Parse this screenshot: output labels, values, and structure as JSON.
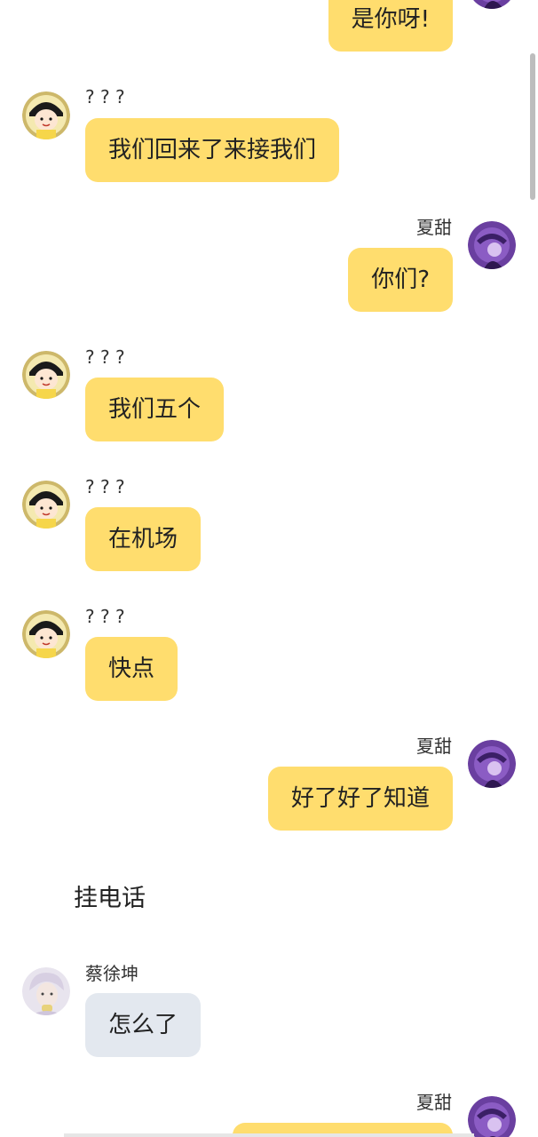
{
  "colors": {
    "bubble_yellow": "#ffdd6e",
    "bubble_grey": "#e3e8ef",
    "background": "#ffffff"
  },
  "messages": [
    {
      "sender": "",
      "side": "right",
      "avatar": "purple-avatar-icon",
      "text": "是你呀!"
    },
    {
      "sender": "? ? ?",
      "side": "left",
      "avatar": "maruko-avatar-icon",
      "text": "我们回来了来接我们"
    },
    {
      "sender": "夏甜",
      "side": "right",
      "avatar": "purple-avatar-icon",
      "text": "你们?"
    },
    {
      "sender": "? ? ?",
      "side": "left",
      "avatar": "maruko-avatar-icon",
      "text": "我们五个"
    },
    {
      "sender": "? ? ?",
      "side": "left",
      "avatar": "maruko-avatar-icon",
      "text": "在机场"
    },
    {
      "sender": "? ? ?",
      "side": "left",
      "avatar": "maruko-avatar-icon",
      "text": "快点"
    },
    {
      "sender": "夏甜",
      "side": "right",
      "avatar": "purple-avatar-icon",
      "text": "好了好了知道"
    },
    {
      "sender": "蔡徐坤",
      "side": "left",
      "avatar": "silver-hair-avatar-icon",
      "text": "怎么了"
    },
    {
      "sender": "夏甜",
      "side": "right",
      "avatar": "purple-avatar-icon",
      "text": ""
    }
  ],
  "narration": "挂电话"
}
